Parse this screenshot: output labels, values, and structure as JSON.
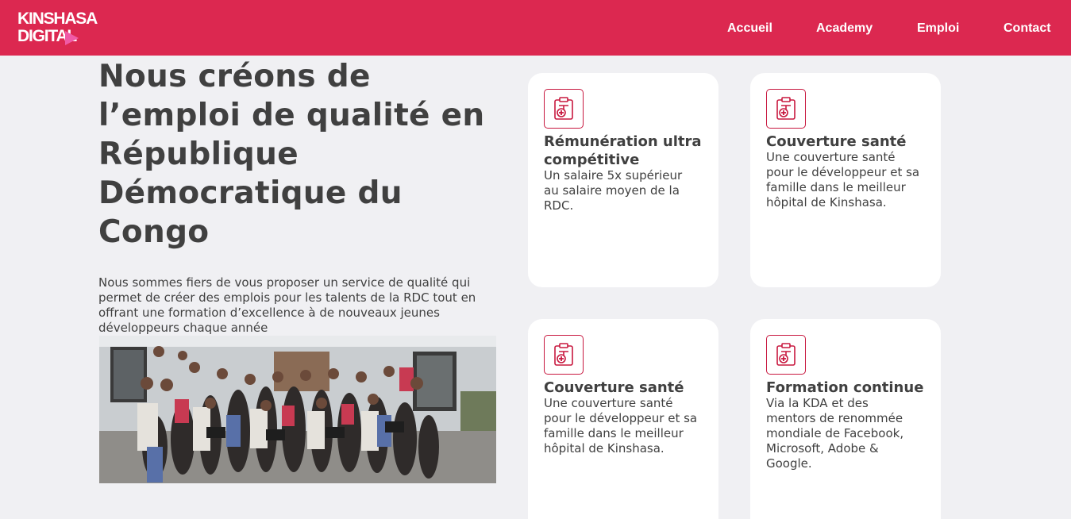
{
  "brand": {
    "line1": "KINSHASA",
    "line2": "DIGITAL",
    "primary_color": "#dc2850"
  },
  "nav": {
    "items": [
      {
        "label": "Accueil"
      },
      {
        "label": "Academy"
      },
      {
        "label": "Emploi"
      },
      {
        "label": "Contact"
      }
    ]
  },
  "hero": {
    "title": "Nous créons de l’emploi de qualité en République Démocratique du Congo",
    "text": "Nous sommes fiers de vous proposer un service de qualité qui permet de créer des emplois pour les talents de la RDC tout en offrant une formation d’excellence à de nouveaux jeunes développeurs chaque année"
  },
  "cards": [
    {
      "icon": "health-clipboard-icon",
      "title": "Rémunération ultra compétitive",
      "desc": "Un salaire 5x supérieur au salaire moyen de la RDC."
    },
    {
      "icon": "health-clipboard-icon",
      "title": "Couverture santé",
      "desc": "Une couverture santé pour le développeur et sa famille dans le meilleur hôpital de Kinshasa."
    },
    {
      "icon": "health-clipboard-icon",
      "title": "Couverture santé",
      "desc": "Une couverture santé pour le développeur et sa famille dans le meilleur hôpital de Kinshasa."
    },
    {
      "icon": "health-clipboard-icon",
      "title": "Formation continue",
      "desc": "Via la KDA et des mentors de renommée mondiale de Facebook, Microsoft, Adobe & Google."
    }
  ]
}
